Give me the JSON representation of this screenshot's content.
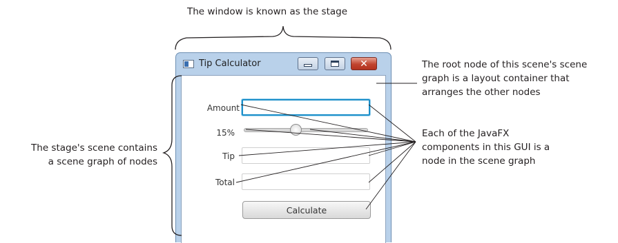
{
  "annotations": {
    "stage": "The window is known as the stage",
    "root_node": [
      "The root node of this scene's scene",
      "graph is a layout container that",
      "arranges the other nodes"
    ],
    "scene": [
      "The stage's scene contains",
      "a scene graph of nodes"
    ],
    "components": [
      "Each of the JavaFX",
      "components in this GUI is a",
      "node in the scene graph"
    ]
  },
  "window": {
    "title": "Tip Calculator",
    "buttons": {
      "minimize_icon": "minimize-icon",
      "maximize_icon": "maximize-icon",
      "close_icon": "close-icon",
      "close_glyph": "✕"
    }
  },
  "form": {
    "amount_label": "Amount",
    "amount_value": "",
    "percent_label": "15%",
    "slider_fraction": 0.42,
    "tip_label": "Tip",
    "tip_value": "",
    "total_label": "Total",
    "total_value": "",
    "calculate_label": "Calculate"
  },
  "colors": {
    "focus_border": "#1c8fc9",
    "window_frame": "#b9d1ea",
    "close_button": "#c0442f"
  }
}
